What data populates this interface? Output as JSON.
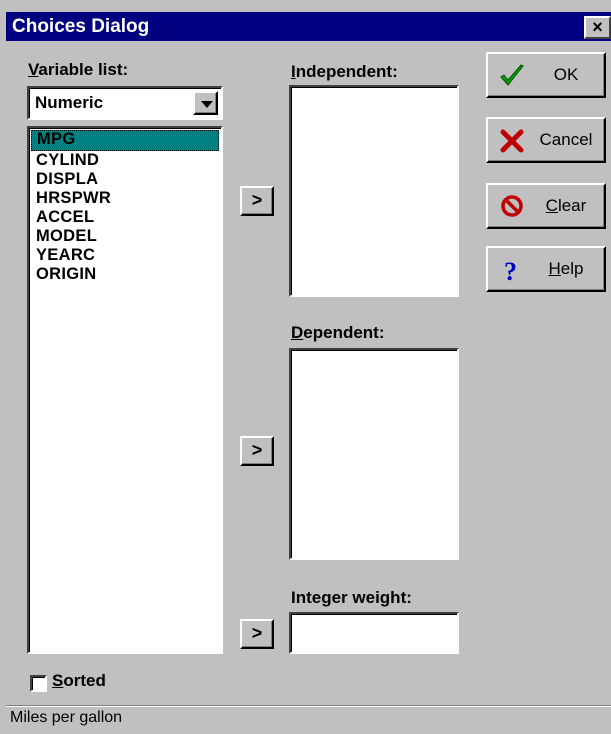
{
  "window": {
    "title": "Choices Dialog",
    "close_label": "×"
  },
  "variable_list": {
    "label_prefix": "V",
    "label_rest": "ariable list:",
    "type_selected": "Numeric",
    "items": [
      "MPG",
      "CYLIND",
      "DISPLA",
      "HRSPWR",
      "ACCEL",
      "MODEL",
      "YEARC",
      "ORIGIN"
    ],
    "selected_index": 0
  },
  "independent": {
    "label_prefix": "I",
    "label_rest": "ndependent:",
    "move_label": ">"
  },
  "dependent": {
    "label_prefix": "D",
    "label_rest": "ependent:",
    "move_label": ">"
  },
  "integer_weight": {
    "label": "Integer weight:",
    "move_label": ">"
  },
  "buttons": {
    "ok": {
      "label": "OK",
      "icon": "checkmark-icon"
    },
    "cancel": {
      "label": "Cancel",
      "icon": "x-icon"
    },
    "clear": {
      "label_prefix": "C",
      "label_rest": "lear",
      "icon": "no-sign-icon"
    },
    "help": {
      "label_prefix": "H",
      "label_rest": "elp",
      "icon": "question-icon"
    }
  },
  "sorted": {
    "label_prefix": "S",
    "label_rest": "orted",
    "checked": false
  },
  "status": {
    "text": "Miles per gallon"
  },
  "colors": {
    "titlebar": "#000080",
    "selection": "#008080",
    "ok_check": "#00a000",
    "cancel_x": "#c00000",
    "clear_sign": "#c00000",
    "help_question": "#0000c0"
  }
}
